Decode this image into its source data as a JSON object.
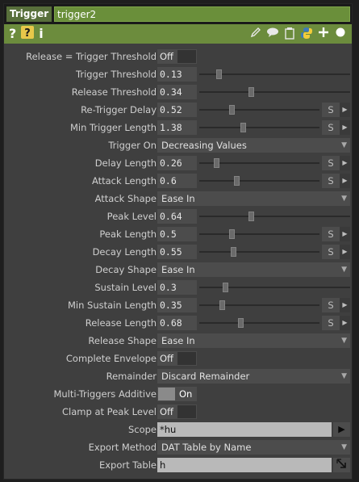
{
  "header": {
    "op_type": "Trigger",
    "op_name": "trigger2"
  },
  "toolbar": {
    "help_icon": "?",
    "py_help_icon": "?",
    "info_icon": "i"
  },
  "params": {
    "p0": {
      "label": "Release = Trigger Threshold",
      "value": "Off"
    },
    "p1": {
      "label": "Trigger Threshold",
      "value": "0.13",
      "fraction": 0.13
    },
    "p2": {
      "label": "Release Threshold",
      "value": "0.34",
      "fraction": 0.34
    },
    "p3": {
      "label": "Re-Trigger Delay",
      "value": "0.52",
      "fraction": 0.27,
      "unit": "S"
    },
    "p4": {
      "label": "Min Trigger Length",
      "value": "1.38",
      "fraction": 0.36,
      "unit": "S"
    },
    "p5": {
      "label": "Trigger On",
      "value": "Decreasing Values"
    },
    "p6": {
      "label": "Delay Length",
      "value": "0.26",
      "fraction": 0.14,
      "unit": "S"
    },
    "p7": {
      "label": "Attack Length",
      "value": "0.6",
      "fraction": 0.31,
      "unit": "S"
    },
    "p8": {
      "label": "Attack Shape",
      "value": "Ease In"
    },
    "p9": {
      "label": "Peak Level",
      "value": "0.64",
      "fraction": 0.34
    },
    "p10": {
      "label": "Peak Length",
      "value": "0.5",
      "fraction": 0.27,
      "unit": "S"
    },
    "p11": {
      "label": "Decay Length",
      "value": "0.55",
      "fraction": 0.28,
      "unit": "S"
    },
    "p12": {
      "label": "Decay Shape",
      "value": "Ease In"
    },
    "p13": {
      "label": "Sustain Level",
      "value": "0.3",
      "fraction": 0.17
    },
    "p14": {
      "label": "Min Sustain Length",
      "value": "0.35",
      "fraction": 0.19,
      "unit": "S"
    },
    "p15": {
      "label": "Release Length",
      "value": "0.68",
      "fraction": 0.34,
      "unit": "S"
    },
    "p16": {
      "label": "Release Shape",
      "value": "Ease In"
    },
    "p17": {
      "label": "Complete Envelope",
      "value": "Off"
    },
    "p18": {
      "label": "Remainder",
      "value": "Discard Remainder"
    },
    "p19": {
      "label": "Multi-Triggers Additive",
      "value": "On"
    },
    "p20": {
      "label": "Clamp at Peak Level",
      "value": "Off"
    },
    "p21": {
      "label": "Scope",
      "value": "*hu"
    },
    "p22": {
      "label": "Export Method",
      "value": "DAT Table by Name"
    },
    "p23": {
      "label": "Export Table",
      "value": "h"
    }
  }
}
